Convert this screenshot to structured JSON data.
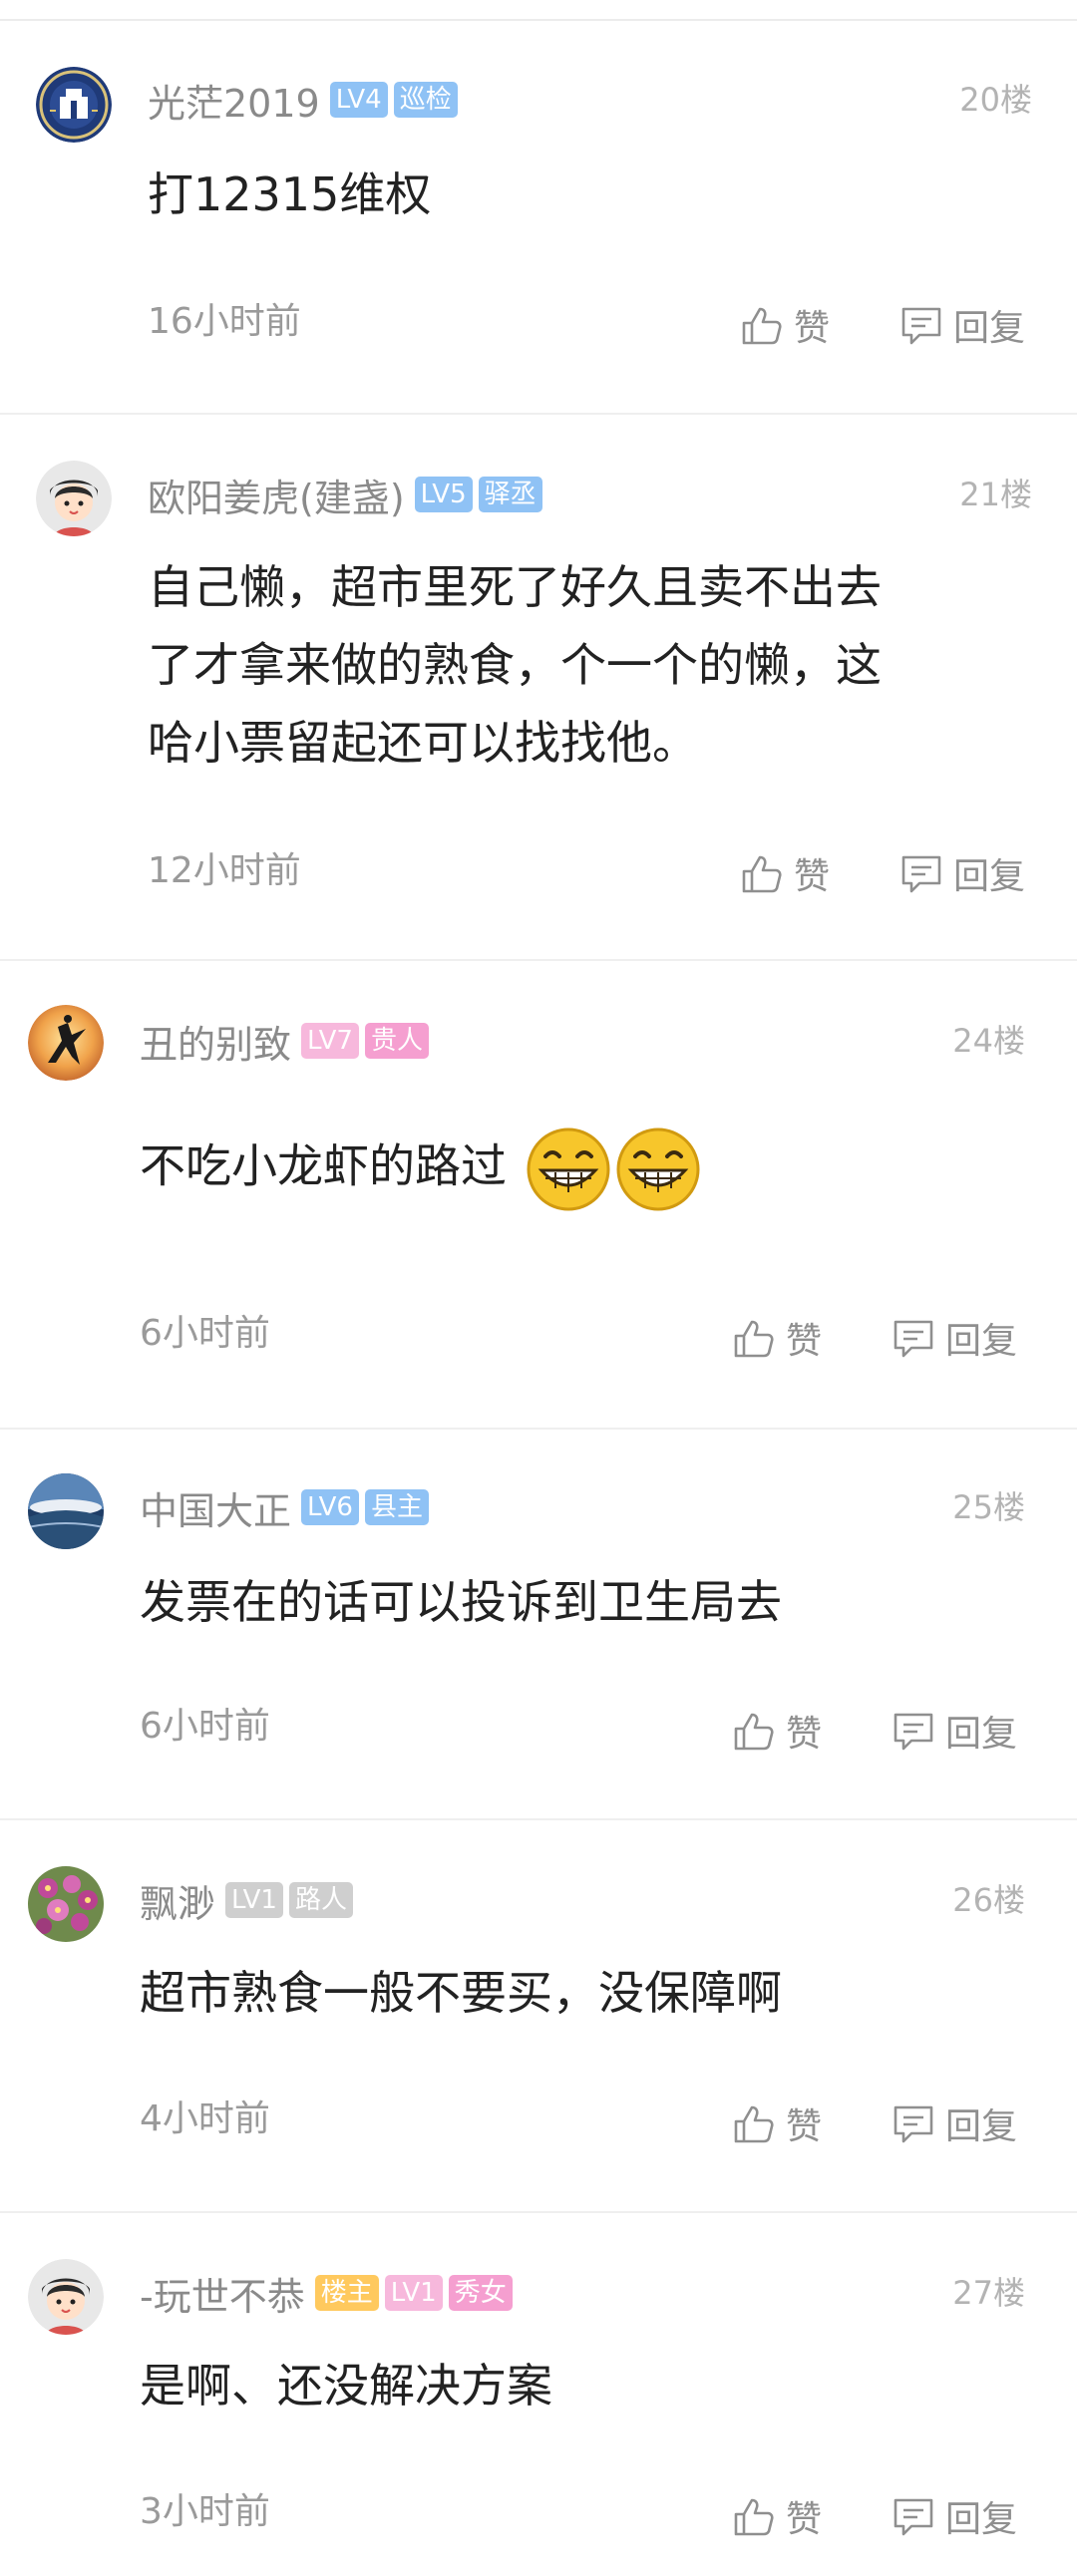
{
  "actions": {
    "like_label": "赞",
    "reply_label": "回复"
  },
  "comments": [
    {
      "username": "光茫2019",
      "badges": [
        {
          "text": "LV4",
          "color": "#8fc2f5"
        },
        {
          "text": "巡检",
          "color": "#8fc2f5"
        }
      ],
      "floor": "20楼",
      "content": [
        "打12315维权"
      ],
      "time": "16小时前",
      "avatar_icon": "emblem-avatar"
    },
    {
      "username": "欧阳姜虎(建盏)",
      "badges": [
        {
          "text": "LV5",
          "color": "#8fc2f5"
        },
        {
          "text": "驿丞",
          "color": "#8fc2f5"
        }
      ],
      "floor": "21楼",
      "content": [
        "自己懒，超市里死了好久且卖不出去",
        "了才拿来做的熟食，个一个的懒，这",
        "哈小票留起还可以找找他。"
      ],
      "time": "12小时前",
      "avatar_icon": "default-user-avatar"
    },
    {
      "username": "丑的别致",
      "badges": [
        {
          "text": "LV7",
          "color": "#f7b8dc"
        },
        {
          "text": "贵人",
          "color": "#f59fd0"
        }
      ],
      "floor": "24楼",
      "content": [
        "不吃小龙虾的路过"
      ],
      "emojis": [
        "grin-emoji",
        "grin-emoji"
      ],
      "time": "6小时前",
      "avatar_icon": "dancer-avatar"
    },
    {
      "username": "中国大正",
      "badges": [
        {
          "text": "LV6",
          "color": "#8fc2f5"
        },
        {
          "text": "县主",
          "color": "#8fc2f5"
        }
      ],
      "floor": "25楼",
      "content": [
        "发票在的话可以投诉到卫生局去"
      ],
      "time": "6小时前",
      "avatar_icon": "landscape-avatar"
    },
    {
      "username": "飘渺",
      "badges": [
        {
          "text": "LV1",
          "color": "#cfcfcf"
        },
        {
          "text": "路人",
          "color": "#cfcfcf"
        }
      ],
      "floor": "26楼",
      "content": [
        "超市熟食一般不要买，没保障啊"
      ],
      "time": "4小时前",
      "avatar_icon": "flowers-avatar"
    },
    {
      "username": "-玩世不恭",
      "badges": [
        {
          "text": "楼主",
          "color": "#ffc95e"
        },
        {
          "text": "LV1",
          "color": "#f7b8dc"
        },
        {
          "text": "秀女",
          "color": "#f59fd0"
        }
      ],
      "floor": "27楼",
      "content": [
        "是啊、还没解决方案"
      ],
      "time": "3小时前",
      "avatar_icon": "default-user-avatar"
    }
  ]
}
